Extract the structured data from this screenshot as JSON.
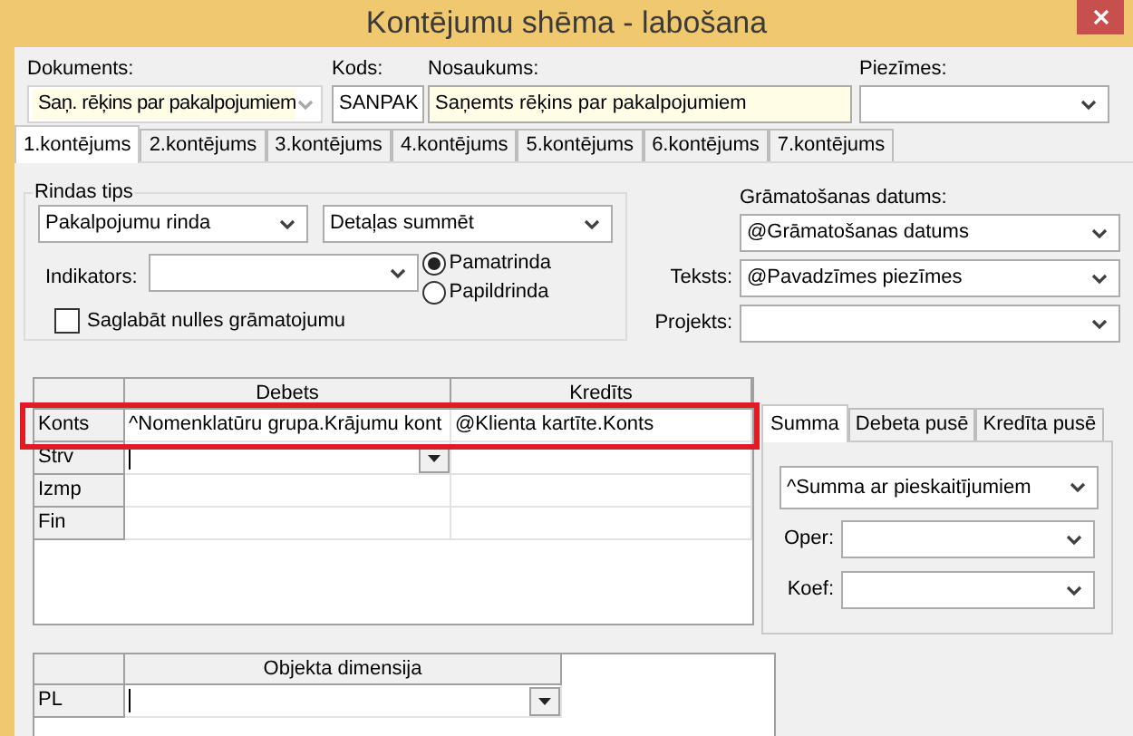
{
  "window": {
    "title": "Kontējumu shēma - labošana"
  },
  "header_fields": [
    {
      "label": "Dokuments:",
      "value": "Saņ. rēķins par pakalpojumiem",
      "kind": "readonly-combo"
    },
    {
      "label": "Kods:",
      "value": "SANPAK",
      "kind": "text"
    },
    {
      "label": "Nosaukums:",
      "value": "Saņemts rēķins par pakalpojumiem",
      "kind": "highlighted-text"
    },
    {
      "label": "Piezīmes:",
      "kind": "combo"
    }
  ],
  "tabs": [
    {
      "label": "1.kontējums",
      "selected": true
    },
    {
      "label": "2.kontējums",
      "selected": false
    },
    {
      "label": "3.kontējums",
      "selected": false
    },
    {
      "label": "4.kontējums",
      "selected": false
    },
    {
      "label": "5.kontējums",
      "selected": false
    },
    {
      "label": "6.kontējums",
      "selected": false
    },
    {
      "label": "7.kontējums",
      "selected": false
    }
  ],
  "row_type": {
    "title": "Rindas tips",
    "selects": [
      "Pakalpojumu rinda",
      "Detaļas summēt"
    ],
    "indicator_label": "Indikators:",
    "radios": [
      {
        "label": "Pamatrinda",
        "selected": true
      },
      {
        "label": "Papildrinda",
        "selected": false
      }
    ],
    "checkbox": {
      "label": "Saglabāt nulles grāmatojumu",
      "checked": false
    }
  },
  "right_fields": [
    {
      "label": "Grāmatošanas datums:",
      "value": "@Grāmatošanas datums",
      "kind": "label-above"
    },
    {
      "label": "Teksts:",
      "value": "@Pavadzīmes piezīmes",
      "kind": "label-left"
    },
    {
      "label": "Projekts:",
      "kind": "label-left"
    }
  ],
  "account_grid": {
    "columns": [
      "Debets",
      "Kredīts"
    ],
    "rows": [
      {
        "label": "Konts",
        "debit": "^Nomenklatūru grupa.Krājumu kont",
        "credit": "@Klienta kartīte.Konts",
        "selected": true,
        "editing": false
      },
      {
        "label": "Strv",
        "selected": false,
        "editing": true
      },
      {
        "label": "Izmp",
        "selected": false,
        "editing": false
      },
      {
        "label": "Fin",
        "selected": false,
        "editing": false
      }
    ]
  },
  "amount_panel": {
    "tabs": [
      {
        "label": "Summa",
        "selected": true
      },
      {
        "label": "Debeta pusē",
        "selected": false
      },
      {
        "label": "Kredīta pusē",
        "selected": false
      }
    ],
    "value": "^Summa ar pieskaitījumiem",
    "fields": [
      {
        "label": "Oper:"
      },
      {
        "label": "Koef:"
      }
    ]
  },
  "dimension_grid": {
    "columns": [
      "Objekta dimensija"
    ],
    "rows": [
      {
        "label": "PL",
        "editing": true
      }
    ]
  }
}
